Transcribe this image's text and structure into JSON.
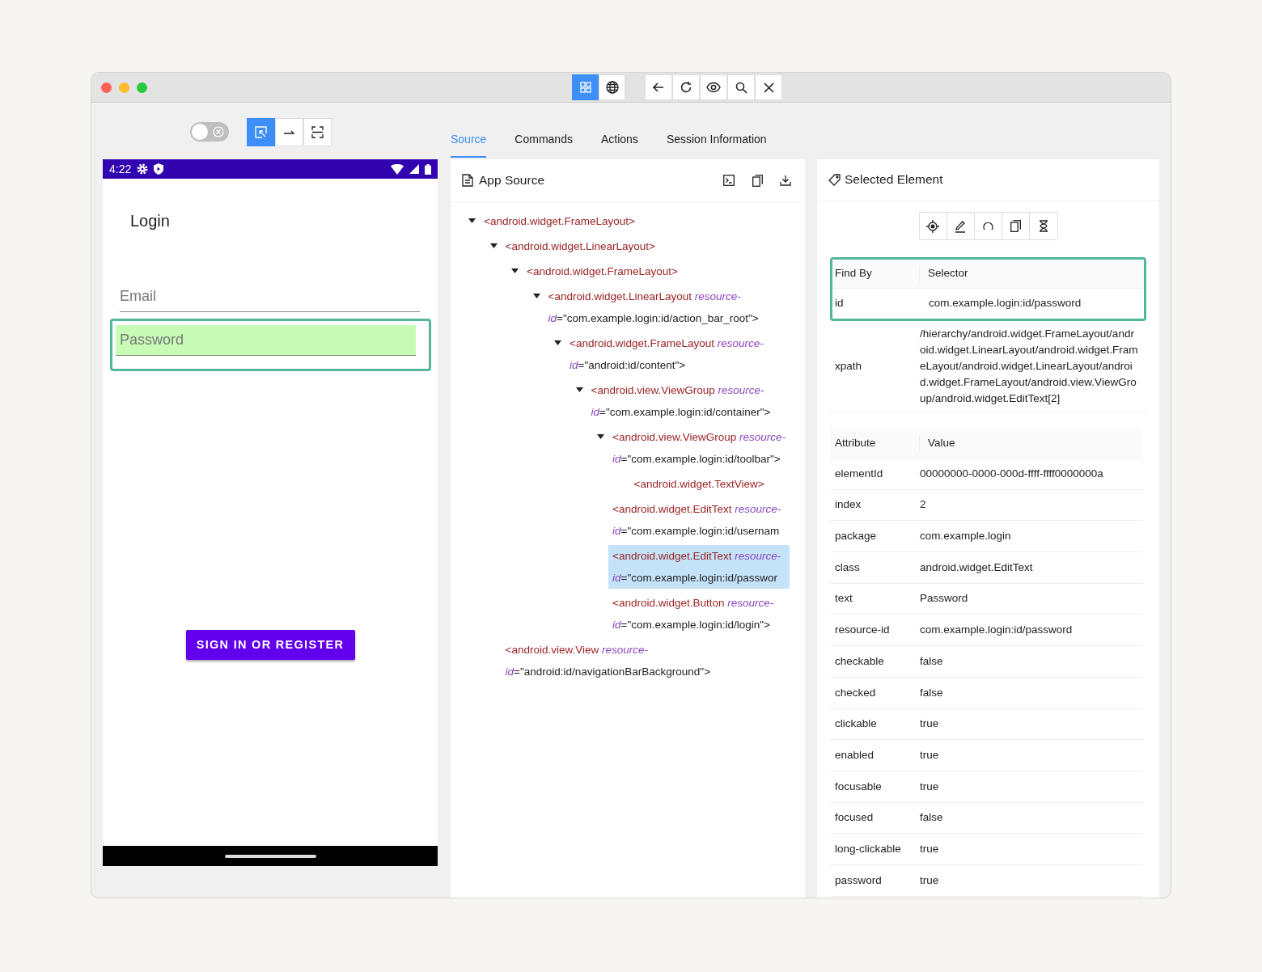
{
  "view_modes": [
    {
      "kind": "native",
      "selected": true
    },
    {
      "kind": "web",
      "selected": false
    }
  ],
  "toolbar": {
    "toggle_on": false,
    "tools": [
      {
        "kind": "select",
        "selected": true
      },
      {
        "kind": "swipe",
        "selected": false
      },
      {
        "kind": "tap",
        "selected": false
      }
    ]
  },
  "tabs": [
    {
      "label": "Source",
      "selected": true
    },
    {
      "label": "Commands",
      "selected": false
    },
    {
      "label": "Actions",
      "selected": false
    },
    {
      "label": "Session Information",
      "selected": false
    }
  ],
  "device": {
    "time": "4:22",
    "title": "Login",
    "fields": [
      {
        "placeholder": "Email",
        "highlighted": false
      },
      {
        "placeholder": "Password",
        "highlighted": true
      }
    ],
    "button": "SIGN IN OR REGISTER"
  },
  "app_source": {
    "title": "App Source",
    "tree": [
      {
        "tag": "<android.widget.FrameLayout>",
        "expanded": true,
        "selected": false,
        "children": [
          {
            "tag": "<android.widget.LinearLayout>",
            "expanded": true,
            "selected": false,
            "children": [
              {
                "tag": "<android.widget.FrameLayout>",
                "expanded": true,
                "selected": false,
                "children": [
                  {
                    "tag": "<android.widget.LinearLayout",
                    "attr": "resource-id",
                    "value": "=\"com.example.login:id/action_bar_root\">",
                    "expanded": true,
                    "selected": false,
                    "children": [
                      {
                        "tag": "<android.widget.FrameLayout",
                        "attr": "resource-id",
                        "value": "=\"android:id/content\">",
                        "expanded": true,
                        "selected": false,
                        "children": [
                          {
                            "tag": "<android.view.ViewGroup",
                            "attr": "resource-id",
                            "value": "=\"com.example.login:id/container\">",
                            "expanded": true,
                            "selected": false,
                            "children": [
                              {
                                "tag": "<android.view.ViewGroup",
                                "attr": "resource-id",
                                "value": "=\"com.example.login:id/toolbar\">",
                                "expanded": true,
                                "selected": false,
                                "children": [
                                  {
                                    "tag": "<android.widget.TextView>",
                                    "selected": false
                                  }
                                ]
                              },
                              {
                                "tag": "<android.widget.EditText",
                                "attr": "resource-id",
                                "value": "=\"com.example.login:id/usernam",
                                "selected": false
                              },
                              {
                                "tag": "<android.widget.EditText",
                                "attr": "resource-id",
                                "value": "=\"com.example.login:id/passwor",
                                "selected": true
                              },
                              {
                                "tag": "<android.widget.Button",
                                "attr": "resource-id",
                                "value": "=\"com.example.login:id/login\">",
                                "selected": false
                              }
                            ]
                          }
                        ]
                      }
                    ]
                  }
                ]
              }
            ]
          },
          {
            "tag": "<android.view.View",
            "attr": "resource-id",
            "value": "=\"android:id/navigationBarBackground\">",
            "selected": false
          }
        ]
      }
    ]
  },
  "selected_element": {
    "title": "Selected Element",
    "find_by": {
      "columns": [
        "Find By",
        "Selector"
      ],
      "rows": [
        {
          "strategy": "id",
          "selector": "com.example.login:id/password"
        }
      ]
    },
    "xpath": {
      "label": "xpath",
      "value": "/hierarchy/android.widget.FrameLayout/android.widget.LinearLayout/android.widget.FrameLayout/android.widget.LinearLayout/android.widget.FrameLayout/android.view.ViewGroup/android.widget.EditText[2]"
    },
    "attributes": {
      "columns": [
        "Attribute",
        "Value"
      ],
      "rows": [
        {
          "name": "elementId",
          "value": "00000000-0000-000d-ffff-ffff0000000a"
        },
        {
          "name": "index",
          "value": "2"
        },
        {
          "name": "package",
          "value": "com.example.login"
        },
        {
          "name": "class",
          "value": "android.widget.EditText"
        },
        {
          "name": "text",
          "value": "Password"
        },
        {
          "name": "resource-id",
          "value": "com.example.login:id/password"
        },
        {
          "name": "checkable",
          "value": "false"
        },
        {
          "name": "checked",
          "value": "false"
        },
        {
          "name": "clickable",
          "value": "true"
        },
        {
          "name": "enabled",
          "value": "true"
        },
        {
          "name": "focusable",
          "value": "true"
        },
        {
          "name": "focused",
          "value": "false"
        },
        {
          "name": "long-clickable",
          "value": "true"
        },
        {
          "name": "password",
          "value": "true"
        }
      ]
    }
  }
}
